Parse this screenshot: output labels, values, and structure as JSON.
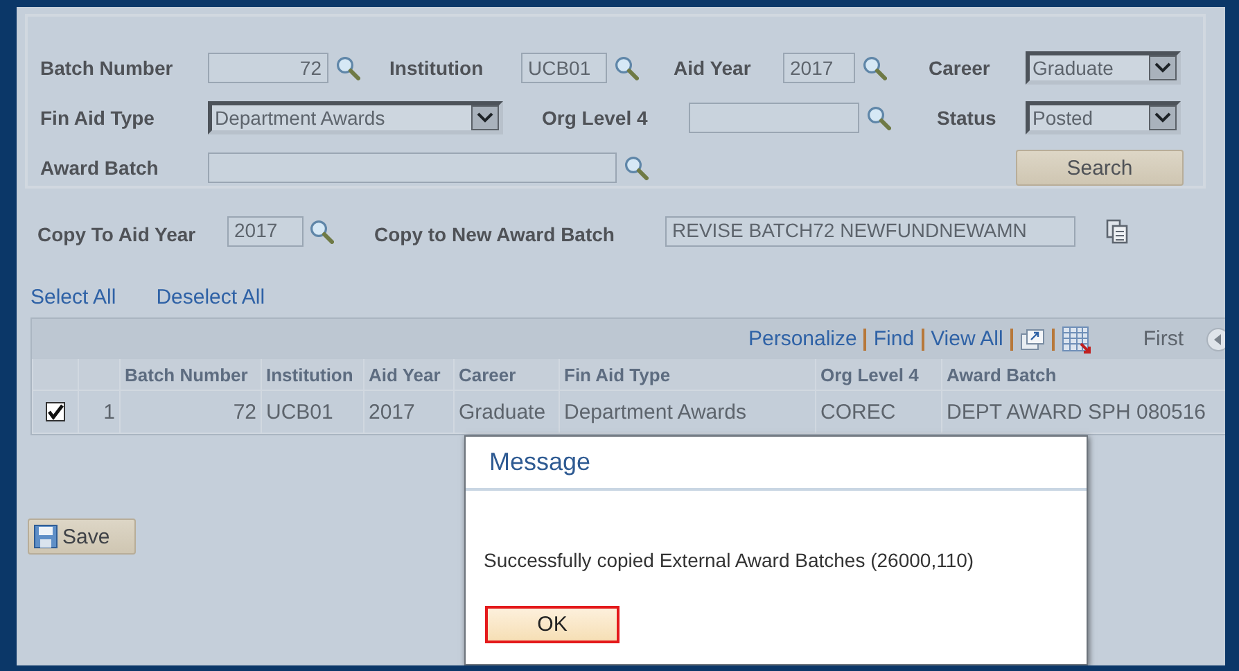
{
  "search": {
    "fields": [
      {
        "label": "Batch Number",
        "kind": "number_lookup",
        "value": "72"
      },
      {
        "label": "Institution",
        "kind": "lookup",
        "value": "UCB01"
      },
      {
        "label": "Aid Year",
        "kind": "lookup",
        "value": "2017"
      },
      {
        "label": "Career",
        "kind": "select",
        "value": "Graduate"
      },
      {
        "label": "Fin Aid Type",
        "kind": "select",
        "value": "Department Awards"
      },
      {
        "label": "Org Level 4",
        "kind": "lookup"
      },
      {
        "label": "Status",
        "kind": "select",
        "value": "Posted"
      },
      {
        "label": "Award Batch",
        "kind": "lookup"
      }
    ],
    "search_button": "Search"
  },
  "copy": {
    "fields": [
      {
        "label": "Copy To Aid Year",
        "kind": "lookup",
        "value": "2017"
      },
      {
        "label": "Copy to New Award Batch",
        "kind": "copy",
        "value": "REVISE BATCH72 NEWFUNDNEWAMN"
      }
    ]
  },
  "links": [
    "Select All",
    "Deselect All"
  ],
  "grid": {
    "toolbar": {
      "links": [
        "Personalize",
        "Find",
        "View All"
      ],
      "first": "First"
    },
    "columns": [
      "Batch Number",
      "Institution",
      "Aid Year",
      "Career",
      "Fin Aid Type",
      "Org Level 4",
      "Award Batch"
    ],
    "rows": [
      {
        "selected": true,
        "row_number": "1",
        "cells": [
          "72",
          "UCB01",
          "2017",
          "Graduate",
          "Department Awards",
          "COREC",
          "DEPT AWARD SPH 080516"
        ]
      }
    ]
  },
  "save_button": "Save",
  "dialog": {
    "title": "Message",
    "message": "Successfully copied External Award Batches (26000,110)",
    "button": "OK"
  }
}
